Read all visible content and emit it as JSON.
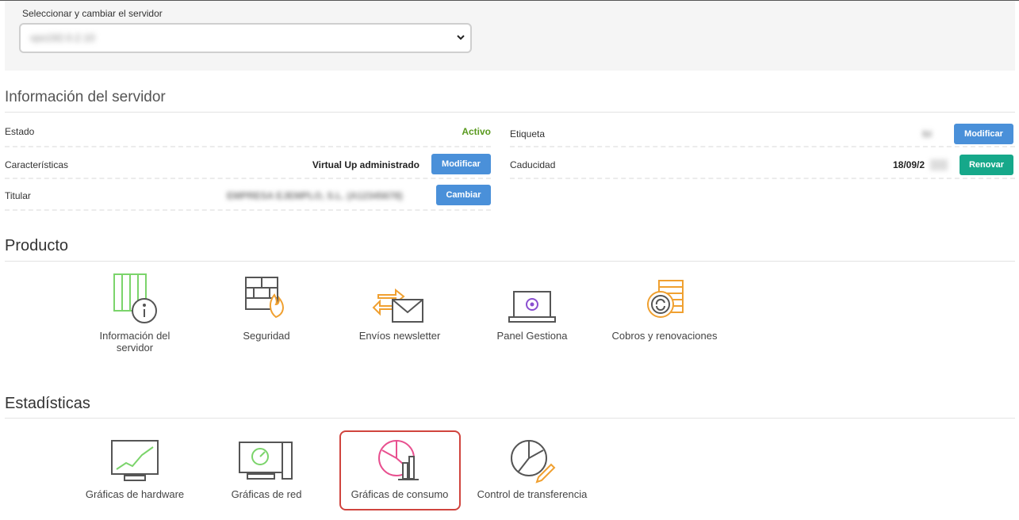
{
  "server_selector": {
    "label": "Seleccionar y cambiar el servidor",
    "selected_value": "vps192.0.2.10"
  },
  "server_info": {
    "title": "Información del servidor",
    "rows_left": [
      {
        "key": "Estado",
        "value": "Activo"
      },
      {
        "key": "Características",
        "value": "Virtual Up administrado",
        "button": "Modificar"
      },
      {
        "key": "Titular",
        "value": "EMPRESA EJEMPLO, S.L. (A12345678)",
        "button": "Cambiar"
      }
    ],
    "rows_right": [
      {
        "key": "Etiqueta",
        "value": "lbl",
        "button": "Modificar"
      },
      {
        "key": "Caducidad",
        "value": "18/09/2",
        "button": "Renovar"
      }
    ]
  },
  "product": {
    "title": "Producto",
    "tiles": [
      {
        "label": "Información del servidor",
        "icon": "server-info-icon"
      },
      {
        "label": "Seguridad",
        "icon": "firewall-icon"
      },
      {
        "label": "Envíos newsletter",
        "icon": "newsletter-icon"
      },
      {
        "label": "Panel Gestiona",
        "icon": "laptop-panel-icon"
      },
      {
        "label": "Cobros y renovaciones",
        "icon": "billing-icon"
      }
    ]
  },
  "stats": {
    "title": "Estadísticas",
    "tiles": [
      {
        "label": "Gráficas de hardware",
        "icon": "hardware-chart-icon"
      },
      {
        "label": "Gráficas de red",
        "icon": "network-chart-icon"
      },
      {
        "label": "Gráficas de consumo",
        "icon": "consumption-chart-icon"
      },
      {
        "label": "Control de transferencia",
        "icon": "transfer-control-icon"
      }
    ]
  },
  "colors": {
    "accent_blue": "#4a90d9",
    "accent_green": "#16a88a",
    "status_active": "#5a9a1f",
    "highlight_red": "#d0443e"
  }
}
